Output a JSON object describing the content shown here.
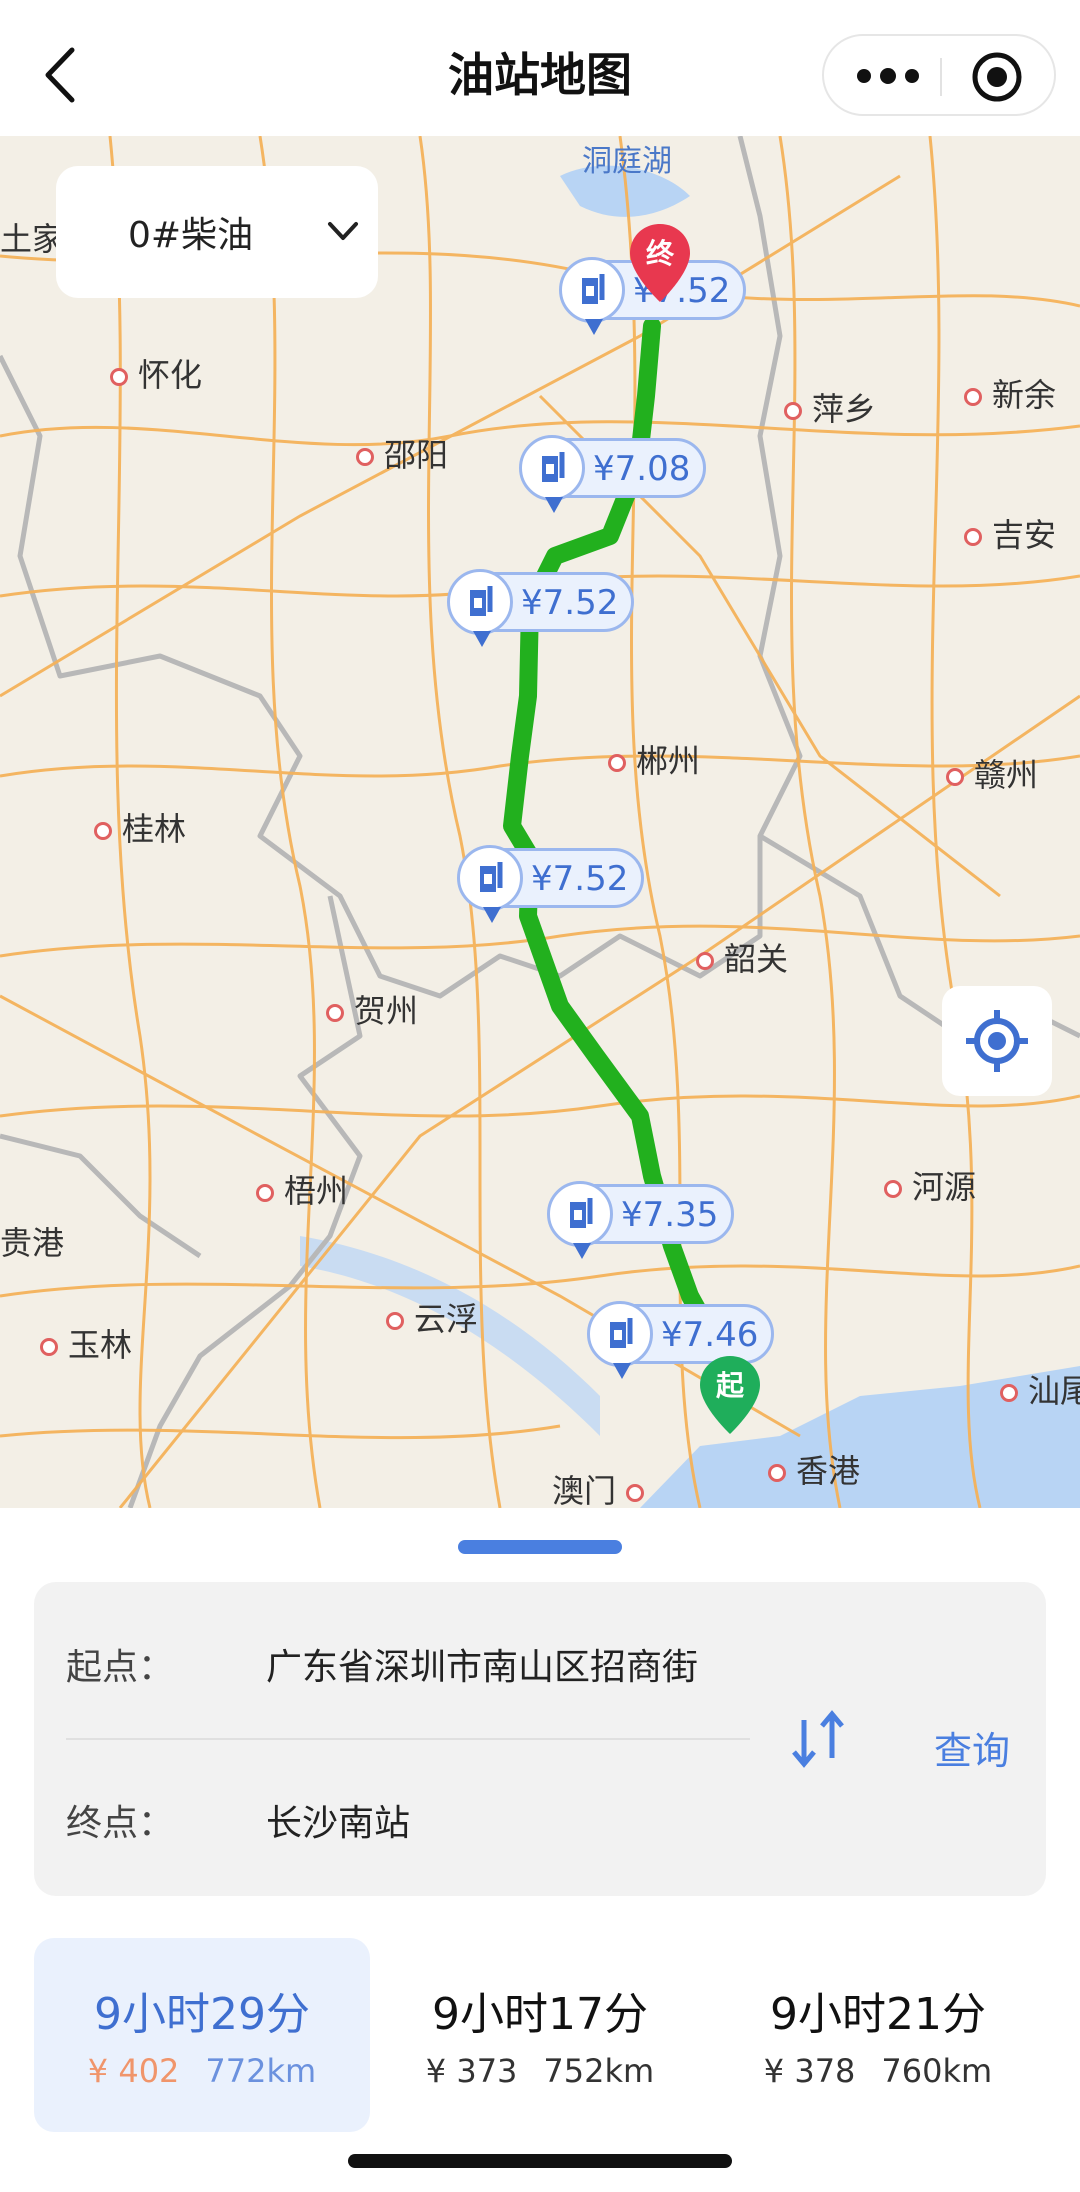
{
  "header": {
    "title": "油站地图",
    "back_icon": "chevron-left-icon",
    "more_icon": "more-dots-icon",
    "close_icon": "target-circle-icon"
  },
  "map": {
    "fuel_type": "0#柴油",
    "lake_label": "洞庭湖",
    "cities": [
      "土家",
      "怀化",
      "邵阳",
      "萍乡",
      "新余",
      "吉安",
      "郴州",
      "赣州",
      "桂林",
      "韶关",
      "贺州",
      "梧州",
      "河源",
      "云浮",
      "贵港",
      "玉林",
      "汕尾",
      "澳门",
      "香港"
    ],
    "price_markers": [
      "¥7.52",
      "¥7.08",
      "¥7.52",
      "¥7.52",
      "¥7.35",
      "¥7.46"
    ],
    "start_pin": "起",
    "end_pin": "终",
    "route_color": "#22b01e"
  },
  "route_card": {
    "origin_label": "起点：",
    "origin_value": "广东省深圳市南山区招商街",
    "destination_label": "终点：",
    "destination_value": "长沙南站",
    "query_label": "查询"
  },
  "route_options": [
    {
      "duration": "9小时29分",
      "cost": "¥ 402",
      "distance": "772km",
      "selected": true
    },
    {
      "duration": "9小时17分",
      "cost": "¥ 373",
      "distance": "752km",
      "selected": false
    },
    {
      "duration": "9小时21分",
      "cost": "¥ 378",
      "distance": "760km",
      "selected": false
    }
  ],
  "colors": {
    "accent": "#4a7fe0",
    "selected_bg": "#eaf1fd",
    "cost_highlight": "#f0956b"
  }
}
